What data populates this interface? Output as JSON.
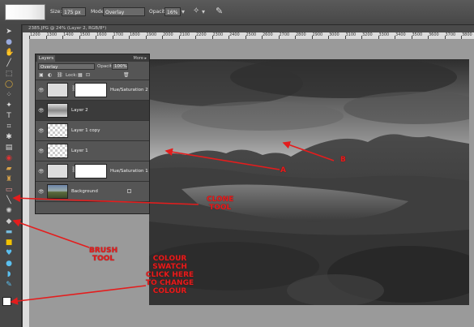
{
  "options_bar": {
    "size_label": "Size:",
    "size_value": "175 px",
    "mode_label": "Mode:",
    "mode_value": "Overlay",
    "opacity_label": "Opacity:",
    "opacity_value": "16%"
  },
  "document": {
    "tab_title": "2385.JPG @ 24% (Layer 2, RGB/8*)"
  },
  "ruler": {
    "ticks": [
      "1200",
      "1300",
      "1400",
      "1500",
      "1600",
      "1700",
      "1800",
      "1900",
      "2000",
      "2100",
      "2200",
      "2300",
      "2400",
      "2500",
      "2600",
      "2700",
      "2800",
      "2900",
      "3000",
      "3100",
      "3200",
      "3300",
      "3400",
      "3500",
      "3600",
      "3700",
      "3800"
    ]
  },
  "layers_panel": {
    "tab_label": "Layers",
    "more_label": "More ▸",
    "blend_mode": "Overlay",
    "opacity_label": "Opacity:",
    "opacity_value": "100%",
    "lock_label": "Lock:",
    "layers": [
      {
        "name": "Hue/Saturation 2",
        "kind": "adjustment",
        "selected": false
      },
      {
        "name": "Layer 2",
        "kind": "photo-strip",
        "selected": true
      },
      {
        "name": "Layer 1 copy",
        "kind": "transparent",
        "selected": false
      },
      {
        "name": "Layer 1",
        "kind": "transparent",
        "selected": false
      },
      {
        "name": "Hue/Saturation 1",
        "kind": "adjustment",
        "selected": false
      },
      {
        "name": "Background",
        "kind": "photo",
        "selected": false,
        "locked": true
      }
    ]
  },
  "annotations": {
    "label_a": "A",
    "label_b": "B",
    "clone_tool": [
      "CLONE",
      "TOOL"
    ],
    "brush_tool": [
      "BRUSH",
      "TOOL"
    ],
    "colour_swatch": [
      "COLOUR",
      "SWATCH",
      "CLICK HERE",
      "TO CHANGE",
      "COLOUR"
    ],
    "color": "#e41d1d"
  },
  "colors": {
    "foreground_swatch": "#ffffff",
    "background_swatch": "#000000"
  }
}
